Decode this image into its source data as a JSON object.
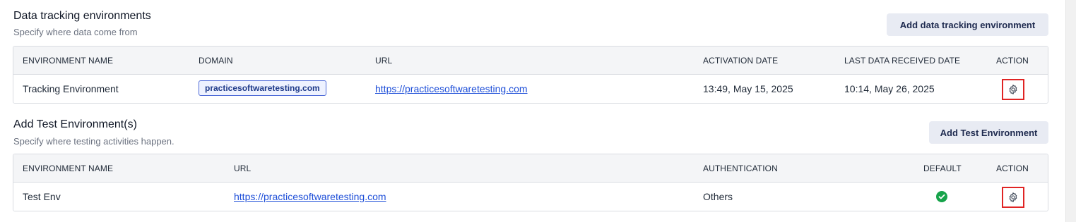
{
  "tracking": {
    "title": "Data tracking environments",
    "subtitle": "Specify where data come from",
    "add_button": "Add data tracking environment",
    "columns": {
      "name": "ENVIRONMENT NAME",
      "domain": "DOMAIN",
      "url": "URL",
      "activation": "ACTIVATION DATE",
      "last_received": "LAST DATA RECEIVED DATE",
      "action": "ACTION"
    },
    "rows": [
      {
        "name": "Tracking Environment",
        "domain": "practicesoftwaretesting.com",
        "url": "https://practicesoftwaretesting.com",
        "activation": "13:49, May 15, 2025",
        "last_received": "10:14, May 26, 2025",
        "action_icon": "gear-icon"
      }
    ]
  },
  "test": {
    "title": "Add Test Environment(s)",
    "subtitle": "Specify where testing activities happen.",
    "add_button": "Add Test Environment",
    "columns": {
      "name": "ENVIRONMENT NAME",
      "url": "URL",
      "auth": "AUTHENTICATION",
      "default": "DEFAULT",
      "action": "ACTION"
    },
    "rows": [
      {
        "name": "Test Env",
        "url": "https://practicesoftwaretesting.com",
        "auth": "Others",
        "default_icon": "check-circle-icon",
        "action_icon": "gear-icon"
      }
    ]
  },
  "colors": {
    "highlight_box": "#e02424",
    "link": "#1d4ed8",
    "default_check": "#16a34a"
  }
}
